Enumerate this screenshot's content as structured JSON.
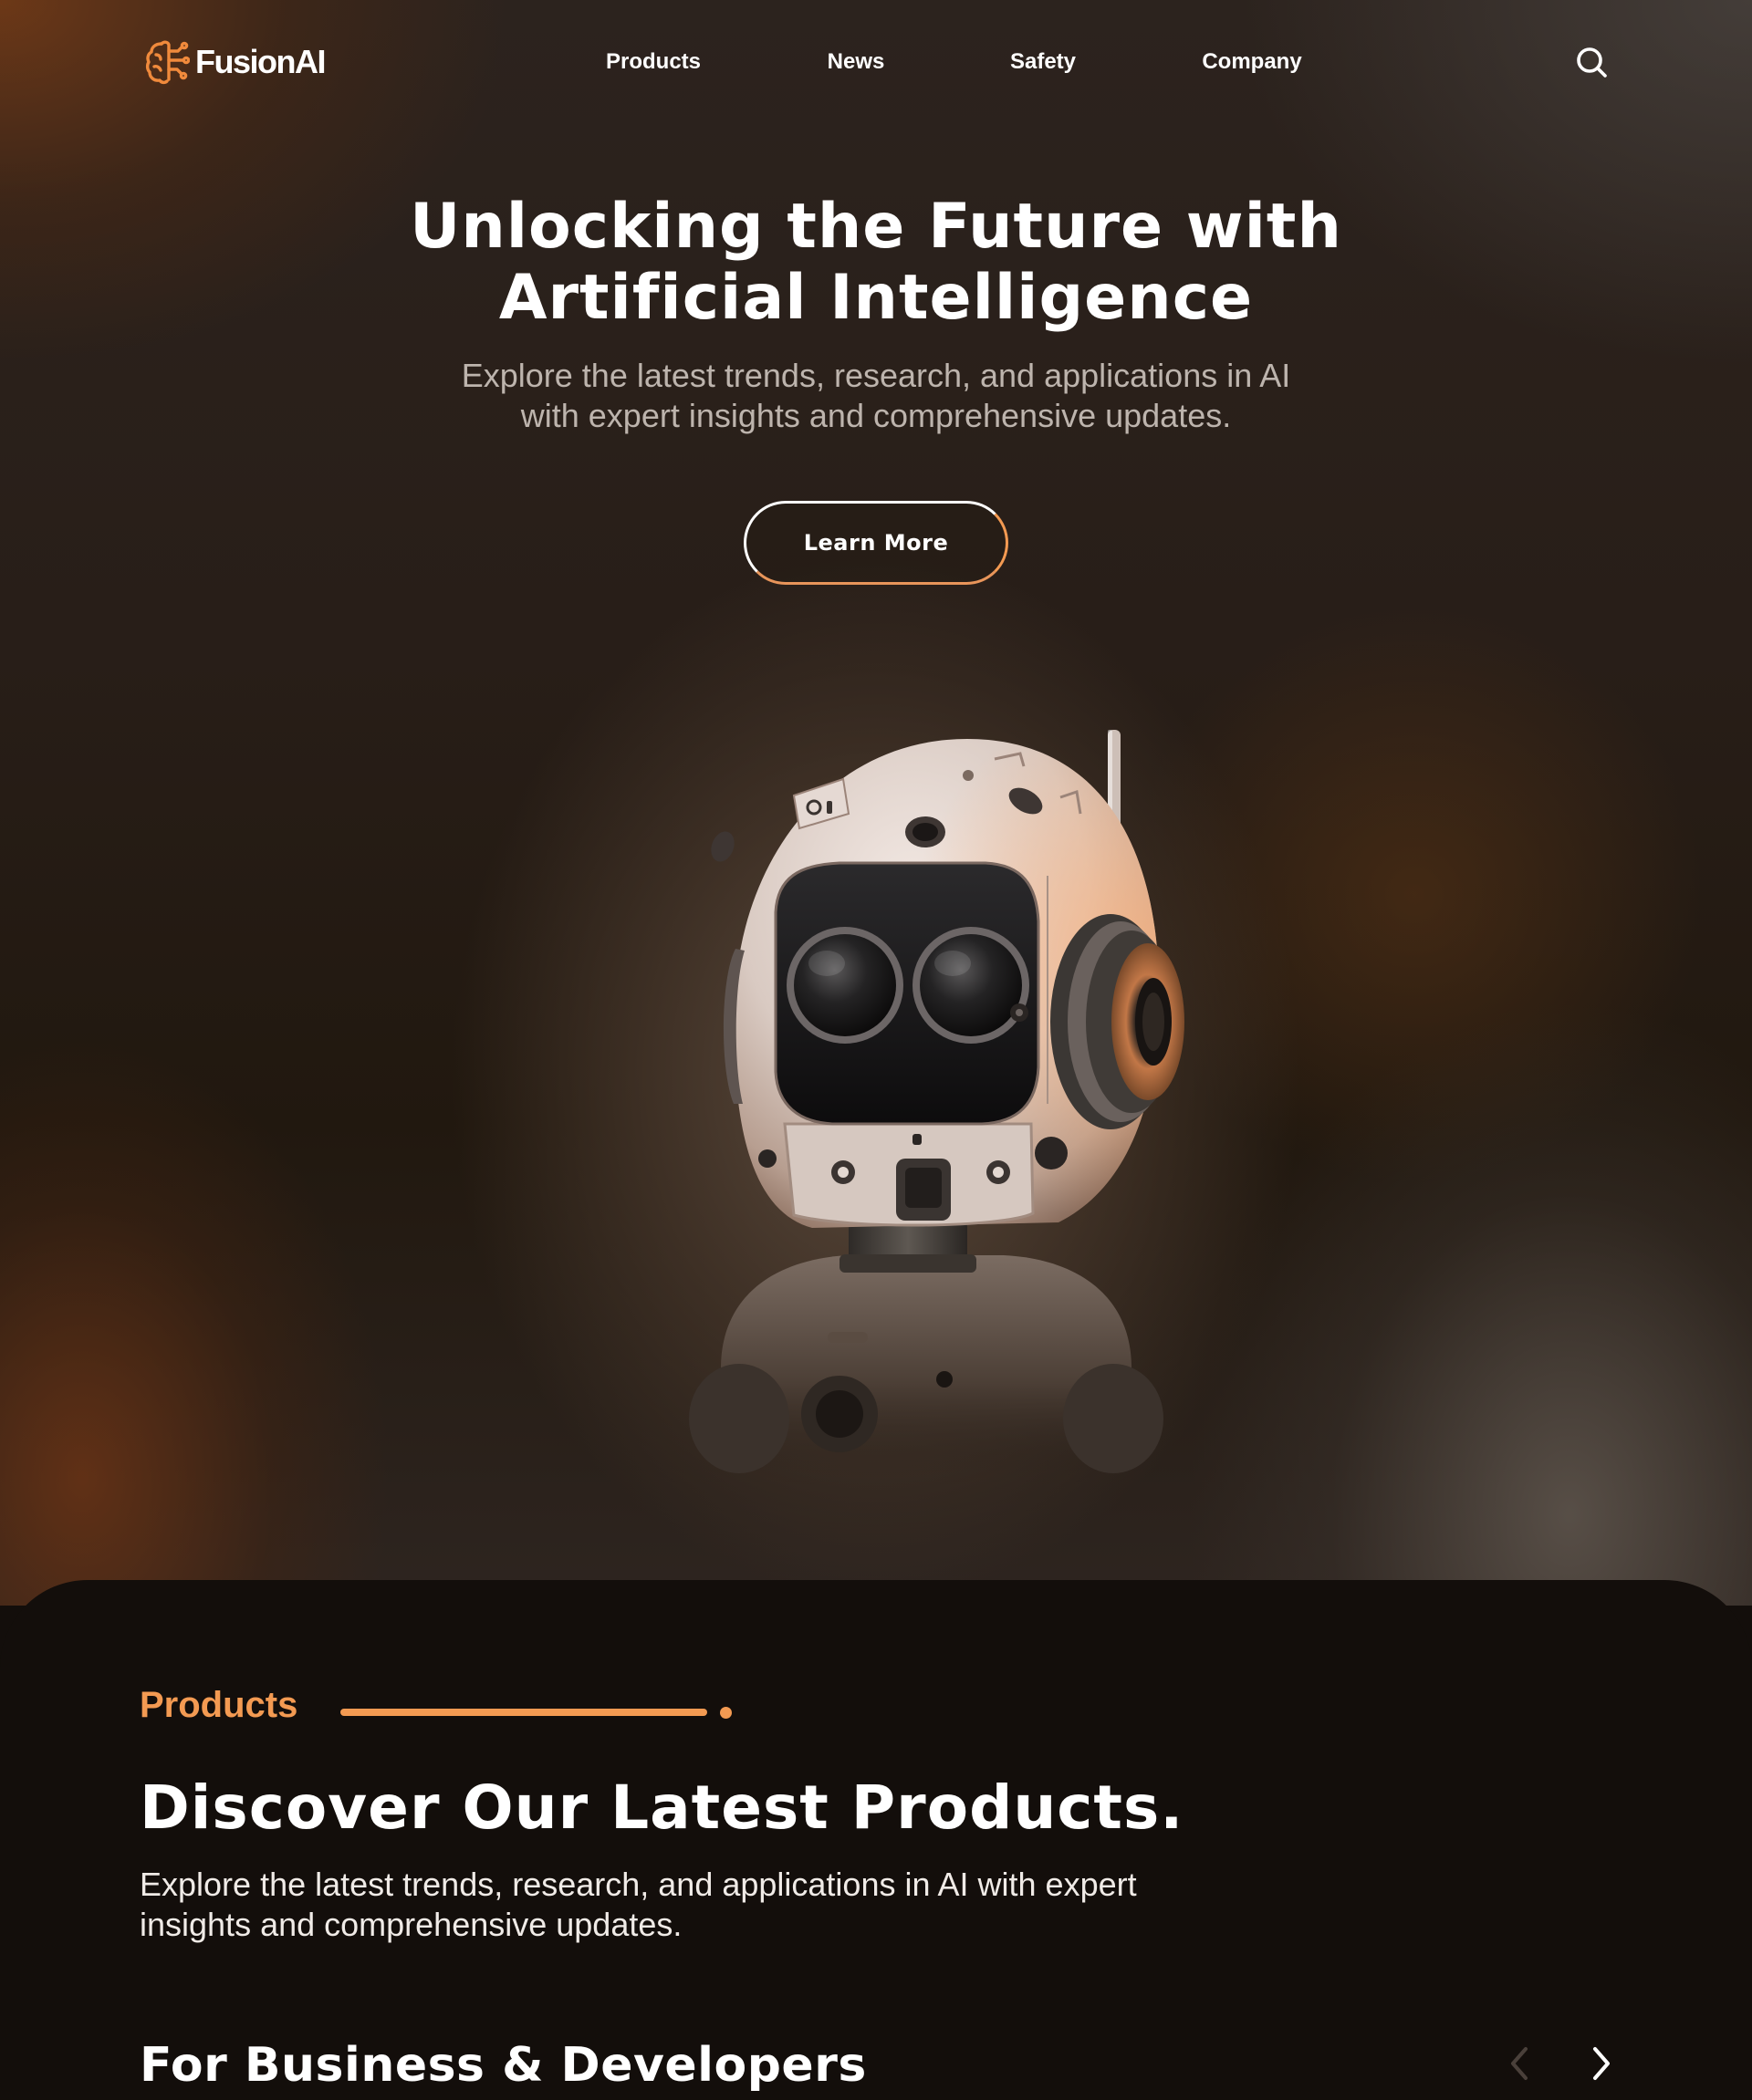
{
  "nav": {
    "brand": "FusionAI",
    "links": [
      {
        "label": "Products"
      },
      {
        "label": "News"
      },
      {
        "label": "Safety"
      },
      {
        "label": "Company"
      }
    ],
    "search_icon": "search-icon"
  },
  "hero": {
    "title_line1": "Unlocking the Future with",
    "title_line2": "Artificial Intelligence",
    "subtitle_line1": "Explore the latest trends, research, and applications in AI",
    "subtitle_line2": "with expert insights and comprehensive updates.",
    "cta_label": "Learn More"
  },
  "products": {
    "eyebrow": "Products",
    "title": "Discover Our Latest Products.",
    "subtitle_line1": "Explore the latest trends, research, and applications in AI with expert",
    "subtitle_line2": "insights and comprehensive updates.",
    "subsection_title": "For Business & Developers",
    "prev_icon": "chevron-left-icon",
    "next_icon": "chevron-right-icon"
  },
  "colors": {
    "accent": "#f39a52",
    "section_bg": "#130e0b",
    "muted_text": "#bdb4ad"
  }
}
